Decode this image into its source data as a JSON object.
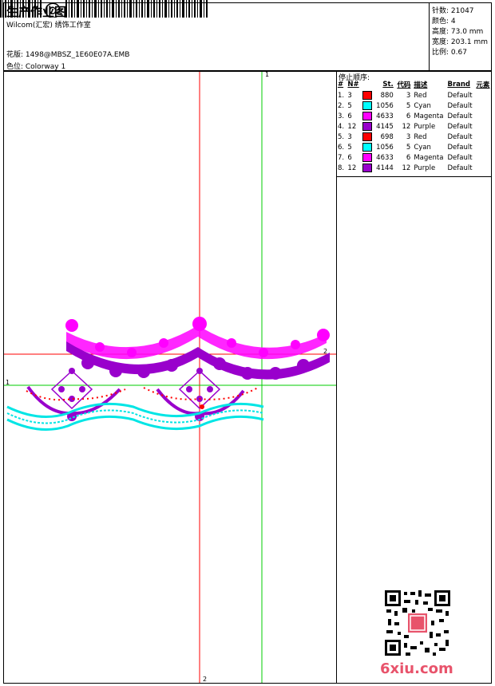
{
  "header": {
    "title": "生产作业图",
    "subtitle": "Wilcom(汇宏) 绣饰工作室",
    "design_file": "花版:  1498@MBSZ_1E60E07A.EMB",
    "colorway": "色位:  Colorway 1"
  },
  "info": {
    "stitches": "针数: 21047",
    "colors": "颜色: 4",
    "height": "高度: 73.0 mm",
    "width": "宽度: 203.1 mm",
    "scale": "比例: 0.67"
  },
  "sequence": {
    "title": "停止顺序:",
    "headers": [
      "#",
      "N#",
      "St.",
      "代码",
      "描述",
      "Brand",
      "元素"
    ],
    "rows": [
      {
        "idx": "1.",
        "n": "3",
        "color": "#ff0000",
        "st": "880",
        "code": "3",
        "desc": "Red",
        "brand": "Default"
      },
      {
        "idx": "2.",
        "n": "5",
        "color": "#00ffff",
        "st": "1056",
        "code": "5",
        "desc": "Cyan",
        "brand": "Default"
      },
      {
        "idx": "3.",
        "n": "6",
        "color": "#ff00ff",
        "st": "4633",
        "code": "6",
        "desc": "Magenta",
        "brand": "Default"
      },
      {
        "idx": "4.",
        "n": "12",
        "color": "#9900cc",
        "st": "4145",
        "code": "12",
        "desc": "Purple",
        "brand": "Default"
      },
      {
        "idx": "5.",
        "n": "3",
        "color": "#ff0000",
        "st": "698",
        "code": "3",
        "desc": "Red",
        "brand": "Default"
      },
      {
        "idx": "6.",
        "n": "5",
        "color": "#00ffff",
        "st": "1056",
        "code": "5",
        "desc": "Cyan",
        "brand": "Default"
      },
      {
        "idx": "7.",
        "n": "6",
        "color": "#ff00ff",
        "st": "4633",
        "code": "6",
        "desc": "Magenta",
        "brand": "Default"
      },
      {
        "idx": "8.",
        "n": "12",
        "color": "#9900cc",
        "st": "4144",
        "code": "12",
        "desc": "Purple",
        "brand": "Default"
      }
    ]
  },
  "guides": {
    "label_1": "1",
    "label_2": "2",
    "label_h1": "1",
    "label_h2": "2"
  },
  "watermark": "6xiu.com",
  "colors": {
    "red": "#ff0000",
    "green": "#00cc00",
    "magenta": "#ff00ff",
    "purple": "#9900cc",
    "cyan": "#00e5e5"
  }
}
